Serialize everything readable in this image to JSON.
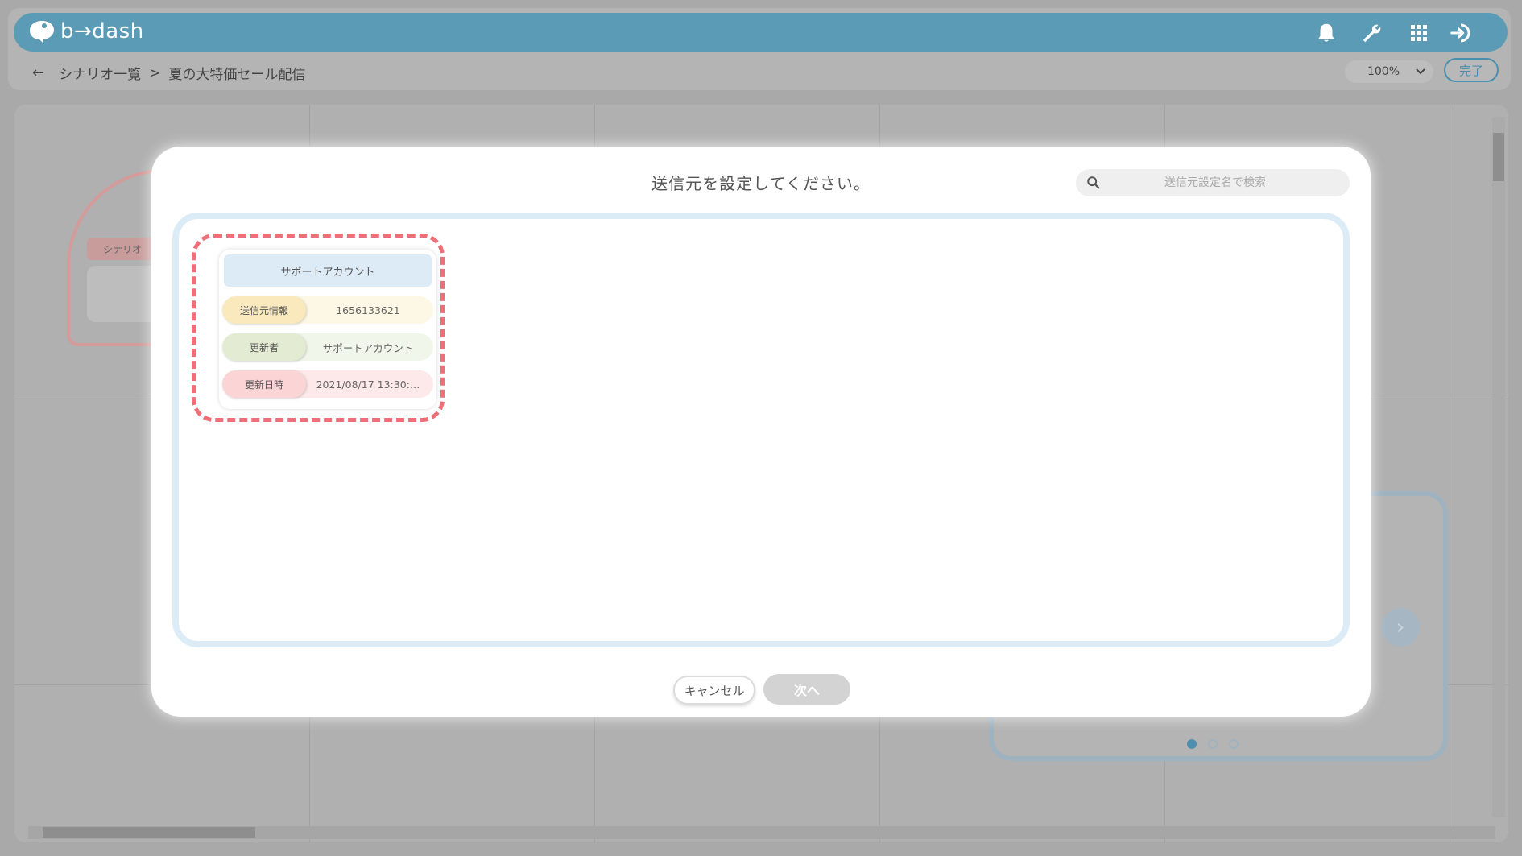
{
  "app": {
    "logo_text": "b→dash",
    "icons": [
      "bell-icon",
      "wrench-icon",
      "apps-grid-icon",
      "logout-icon"
    ]
  },
  "breadcrumb": {
    "parent": "シナリオ一覧",
    "separator": ">",
    "current": "夏の大特価セール配信"
  },
  "toolbar": {
    "zoom_value": "100%",
    "done_label": "完了"
  },
  "background": {
    "node_label": "シナリオ"
  },
  "modal": {
    "title": "送信元を設定してください。",
    "search_placeholder": "送信元設定名で検索",
    "card": {
      "title": "サポートアカウント",
      "rows": [
        {
          "label": "送信元情報",
          "value": "1656133621"
        },
        {
          "label": "更新者",
          "value": "サポートアカウント"
        },
        {
          "label": "更新日時",
          "value": "2021/08/17 13:30:…"
        }
      ]
    },
    "cancel_label": "キャンセル",
    "next_label": "次へ"
  },
  "colors": {
    "header": "#5c9bb5",
    "highlight": "#ef6f78",
    "list_border": "#dcecf7"
  }
}
